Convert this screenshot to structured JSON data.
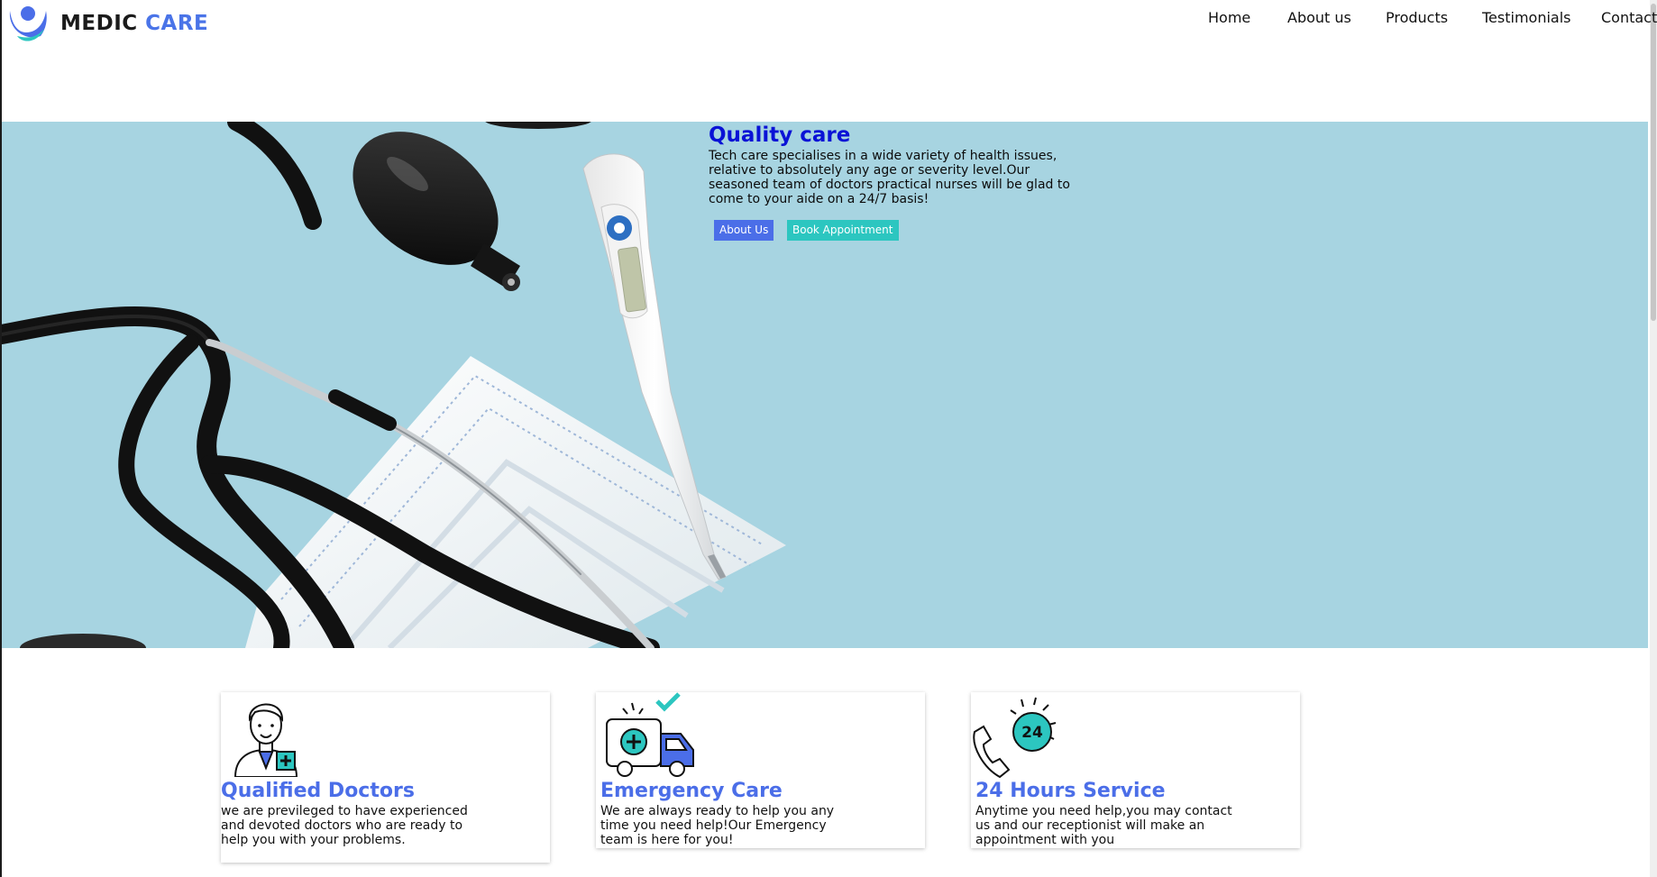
{
  "brand": {
    "name_part1": "MEDIC",
    "name_part2": "CARE",
    "colors": {
      "primary": "#4b6ee8",
      "teal": "#2cc6c0",
      "title_blue": "#0a12d6",
      "hero_bg": "#a7d4e1"
    }
  },
  "nav": {
    "items": [
      {
        "label": "Home"
      },
      {
        "label": "About us"
      },
      {
        "label": "Products"
      },
      {
        "label": "Testimonials"
      },
      {
        "label": "Contact"
      }
    ]
  },
  "hero": {
    "title": "Quality care",
    "description": "Tech care specialises in a wide variety of health issues, relative to absolutely any age or severity level.Our seasoned team of doctors practical nurses will be glad to come to your aide on a 24/7 basis!",
    "buttons": {
      "about": "About Us",
      "book": "Book Appointment"
    },
    "image": {
      "icons": [
        "stethoscope",
        "face-mask",
        "digital-thermometer"
      ]
    }
  },
  "services": [
    {
      "icon": "doctor-icon",
      "title": "Qualified Doctors",
      "description": "we are previleged to have experienced and devoted doctors who are ready to help you with your problems."
    },
    {
      "icon": "ambulance-icon",
      "title": "Emergency Care",
      "description": "We are always ready to help you any time you need help!Our Emergency team is here for you!"
    },
    {
      "icon": "phone-24-icon",
      "title": "24 Hours Service",
      "description": "Anytime you need help,you may contact us and our receptionist will make an appointment with you"
    }
  ],
  "service_icon_badge": "24"
}
